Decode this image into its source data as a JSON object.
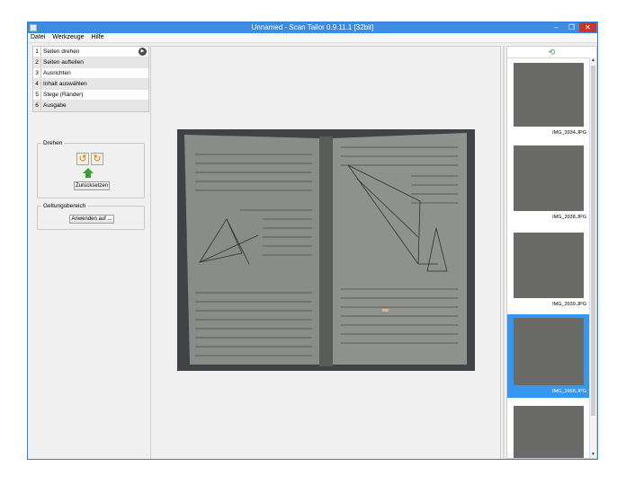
{
  "window": {
    "title": "Unnamed - Scan Tailor 0.9.11.1 [32bit]"
  },
  "menu": [
    "Datei",
    "Werkzeuge",
    "Hilfe"
  ],
  "stages": [
    {
      "num": "1",
      "label": "Seiten drehen"
    },
    {
      "num": "2",
      "label": "Seiten aufteilen"
    },
    {
      "num": "3",
      "label": "Ausrichten"
    },
    {
      "num": "4",
      "label": "Inhalt auswählen"
    },
    {
      "num": "5",
      "label": "Stege (Ränder)"
    },
    {
      "num": "6",
      "label": "Ausgabe"
    }
  ],
  "rotate_group": {
    "title": "Drehen",
    "reset_label": "Zurücksetzen"
  },
  "scope_group": {
    "title": "Geltungsbereich",
    "apply_label": "Anwenden auf ..."
  },
  "thumbnails": [
    {
      "caption": "IMG_3934.JPG",
      "selected": false
    },
    {
      "caption": "IMG_3938.JPG",
      "selected": false
    },
    {
      "caption": "IMG_3939.JPG",
      "selected": false
    },
    {
      "caption": "IMG_3958.JPG",
      "selected": true
    },
    {
      "caption": "",
      "selected": false
    }
  ],
  "colors": {
    "titlebar": "#3b8ce2",
    "selection": "#3797f0",
    "close": "#c7372f"
  },
  "icons": [
    "app-icon",
    "minimize-icon",
    "maximize-icon",
    "close-icon",
    "play-icon",
    "rotate-left-icon",
    "rotate-right-icon",
    "up-arrow-icon",
    "sync-icon"
  ]
}
